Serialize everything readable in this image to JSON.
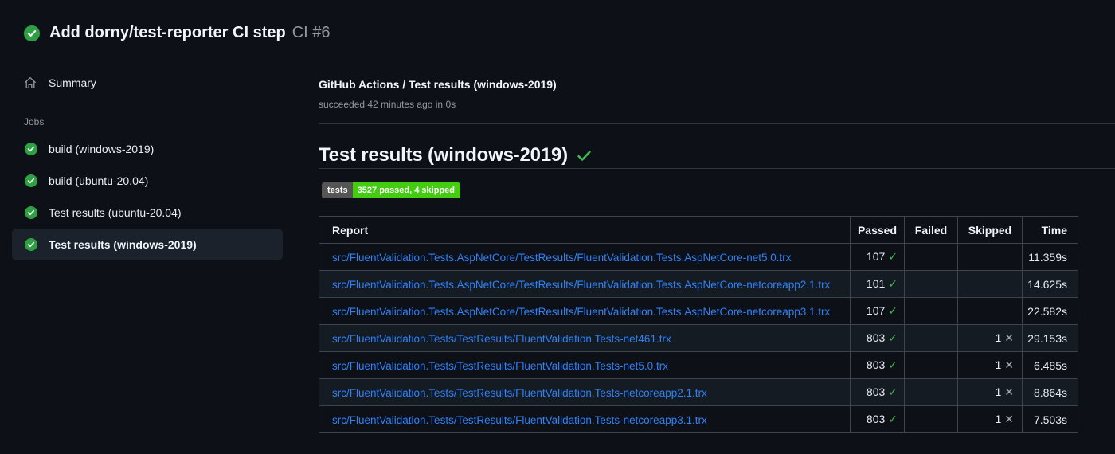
{
  "run_header": {
    "title": "Add dorny/test-reporter CI step",
    "run_number": "CI #6"
  },
  "sidebar": {
    "summary_label": "Summary",
    "jobs_label": "Jobs",
    "jobs": [
      {
        "label": "build (windows-2019)",
        "selected": false
      },
      {
        "label": "build (ubuntu-20.04)",
        "selected": false
      },
      {
        "label": "Test results (ubuntu-20.04)",
        "selected": false
      },
      {
        "label": "Test results (windows-2019)",
        "selected": true
      }
    ]
  },
  "main": {
    "job_title": "GitHub Actions / Test results (windows-2019)",
    "job_status": "succeeded 42 minutes ago in 0s",
    "section_heading": "Test results (windows-2019)",
    "badge": {
      "label": "tests",
      "value": "3527 passed, 4 skipped"
    },
    "table": {
      "headers": [
        "Report",
        "Passed",
        "Failed",
        "Skipped",
        "Time"
      ],
      "rows": [
        {
          "report": "src/FluentValidation.Tests.AspNetCore/TestResults/FluentValidation.Tests.AspNetCore-net5.0.trx",
          "passed": "107",
          "failed": "",
          "skipped": "",
          "time": "11.359s"
        },
        {
          "report": "src/FluentValidation.Tests.AspNetCore/TestResults/FluentValidation.Tests.AspNetCore-netcoreapp2.1.trx",
          "passed": "101",
          "failed": "",
          "skipped": "",
          "time": "14.625s"
        },
        {
          "report": "src/FluentValidation.Tests.AspNetCore/TestResults/FluentValidation.Tests.AspNetCore-netcoreapp3.1.trx",
          "passed": "107",
          "failed": "",
          "skipped": "",
          "time": "22.582s"
        },
        {
          "report": "src/FluentValidation.Tests/TestResults/FluentValidation.Tests-net461.trx",
          "passed": "803",
          "failed": "",
          "skipped": "1",
          "time": "29.153s"
        },
        {
          "report": "src/FluentValidation.Tests/TestResults/FluentValidation.Tests-net5.0.trx",
          "passed": "803",
          "failed": "",
          "skipped": "1",
          "time": "6.485s"
        },
        {
          "report": "src/FluentValidation.Tests/TestResults/FluentValidation.Tests-netcoreapp2.1.trx",
          "passed": "803",
          "failed": "",
          "skipped": "1",
          "time": "8.864s"
        },
        {
          "report": "src/FluentValidation.Tests/TestResults/FluentValidation.Tests-netcoreapp3.1.trx",
          "passed": "803",
          "failed": "",
          "skipped": "1",
          "time": "7.503s"
        }
      ]
    }
  },
  "icons": {
    "pass_check": "✓",
    "skip_x": "✕"
  },
  "colors": {
    "bg": "#0d1117",
    "fg": "#e6edf3",
    "fg_bright": "#f0f6fc",
    "muted": "#9198a1",
    "border": "#3d444d",
    "divider": "#30363d",
    "link": "#2f81f7",
    "green": "#2ea043",
    "check": "#3fb950",
    "pill": "#1c222b",
    "stripe": "#151b23",
    "badge_label_bg": "#555555",
    "badge_value_bg": "#44cc11",
    "x_color": "#a2aab4"
  }
}
